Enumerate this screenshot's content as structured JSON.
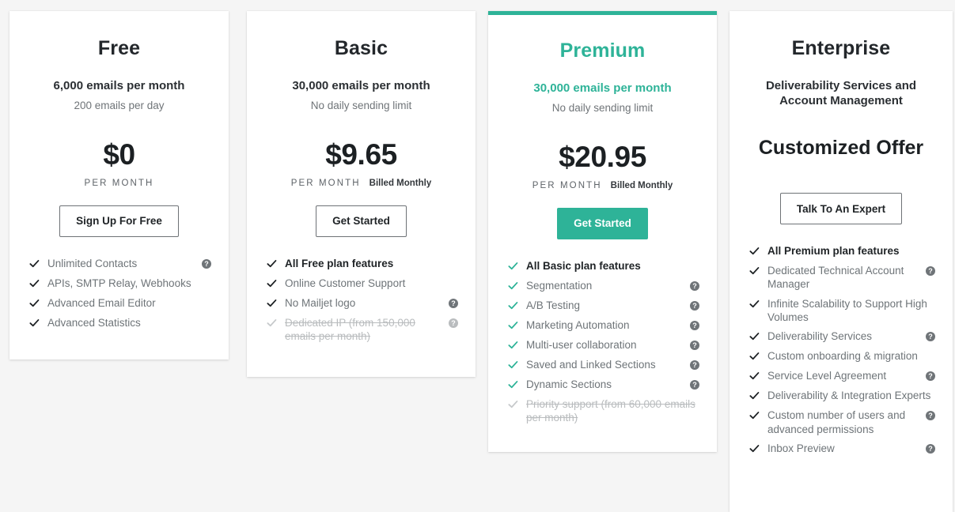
{
  "page": {
    "background_color": "#f5f5f5",
    "accent_color": "#2eb398",
    "help_icon_glyph": "?"
  },
  "plans": [
    {
      "id": "free",
      "name": "Free",
      "volume": "6,000 emails per month",
      "subvolume": "200 emails per day",
      "price": "$0",
      "per_month_label": "PER MONTH",
      "billed_label": "",
      "cta_label": "Sign Up For Free",
      "cta_style": "outline",
      "highlighted": false,
      "features": [
        {
          "label": "Unlimited Contacts",
          "strong": false,
          "muted": false,
          "help": true
        },
        {
          "label": "APIs, SMTP Relay, Webhooks",
          "strong": false,
          "muted": false,
          "help": false
        },
        {
          "label": "Advanced Email Editor",
          "strong": false,
          "muted": false,
          "help": false
        },
        {
          "label": "Advanced Statistics",
          "strong": false,
          "muted": false,
          "help": false
        }
      ]
    },
    {
      "id": "basic",
      "name": "Basic",
      "volume": "30,000 emails per month",
      "subvolume": "No daily sending limit",
      "price": "$9.65",
      "per_month_label": "PER MONTH",
      "billed_label": "Billed Monthly",
      "cta_label": "Get Started",
      "cta_style": "outline",
      "highlighted": false,
      "features": [
        {
          "label": "All Free plan features",
          "strong": true,
          "muted": false,
          "help": false
        },
        {
          "label": "Online Customer Support",
          "strong": false,
          "muted": false,
          "help": false
        },
        {
          "label": "No Mailjet logo",
          "strong": false,
          "muted": false,
          "help": true
        },
        {
          "label": "Dedicated IP (from 150,000 emails per month)",
          "strong": false,
          "muted": true,
          "help": true
        }
      ]
    },
    {
      "id": "premium",
      "name": "Premium",
      "volume": "30,000 emails per month",
      "subvolume": "No daily sending limit",
      "price": "$20.95",
      "per_month_label": "PER MONTH",
      "billed_label": "Billed Monthly",
      "cta_label": "Get Started",
      "cta_style": "primary",
      "highlighted": true,
      "features": [
        {
          "label": "All Basic plan features",
          "strong": true,
          "muted": false,
          "help": false
        },
        {
          "label": "Segmentation",
          "strong": false,
          "muted": false,
          "help": true
        },
        {
          "label": "A/B Testing",
          "strong": false,
          "muted": false,
          "help": true
        },
        {
          "label": "Marketing Automation",
          "strong": false,
          "muted": false,
          "help": true
        },
        {
          "label": "Multi-user collaboration",
          "strong": false,
          "muted": false,
          "help": true
        },
        {
          "label": "Saved and Linked Sections",
          "strong": false,
          "muted": false,
          "help": true
        },
        {
          "label": "Dynamic Sections",
          "strong": false,
          "muted": false,
          "help": true
        },
        {
          "label": "Priority support (from 60,000 emails per month)",
          "strong": false,
          "muted": true,
          "help": false
        }
      ]
    },
    {
      "id": "enterprise",
      "name": "Enterprise",
      "volume": "Deliverability Services and Account Management",
      "subvolume": "",
      "price": "Customized Offer",
      "per_month_label": "",
      "billed_label": "",
      "cta_label": "Talk To An Expert",
      "cta_style": "outline",
      "highlighted": false,
      "features": [
        {
          "label": "All Premium plan features",
          "strong": true,
          "muted": false,
          "help": false
        },
        {
          "label": "Dedicated Technical Account Manager",
          "strong": false,
          "muted": false,
          "help": true
        },
        {
          "label": "Infinite Scalability to Support High Volumes",
          "strong": false,
          "muted": false,
          "help": false
        },
        {
          "label": "Deliverability Services",
          "strong": false,
          "muted": false,
          "help": true
        },
        {
          "label": "Custom onboarding & migration",
          "strong": false,
          "muted": false,
          "help": false
        },
        {
          "label": "Service Level Agreement",
          "strong": false,
          "muted": false,
          "help": true
        },
        {
          "label": "Deliverability & Integration Experts",
          "strong": false,
          "muted": false,
          "help": false
        },
        {
          "label": "Custom number of users and advanced permissions",
          "strong": false,
          "muted": false,
          "help": true
        },
        {
          "label": "Inbox Preview",
          "strong": false,
          "muted": false,
          "help": true
        }
      ]
    }
  ]
}
